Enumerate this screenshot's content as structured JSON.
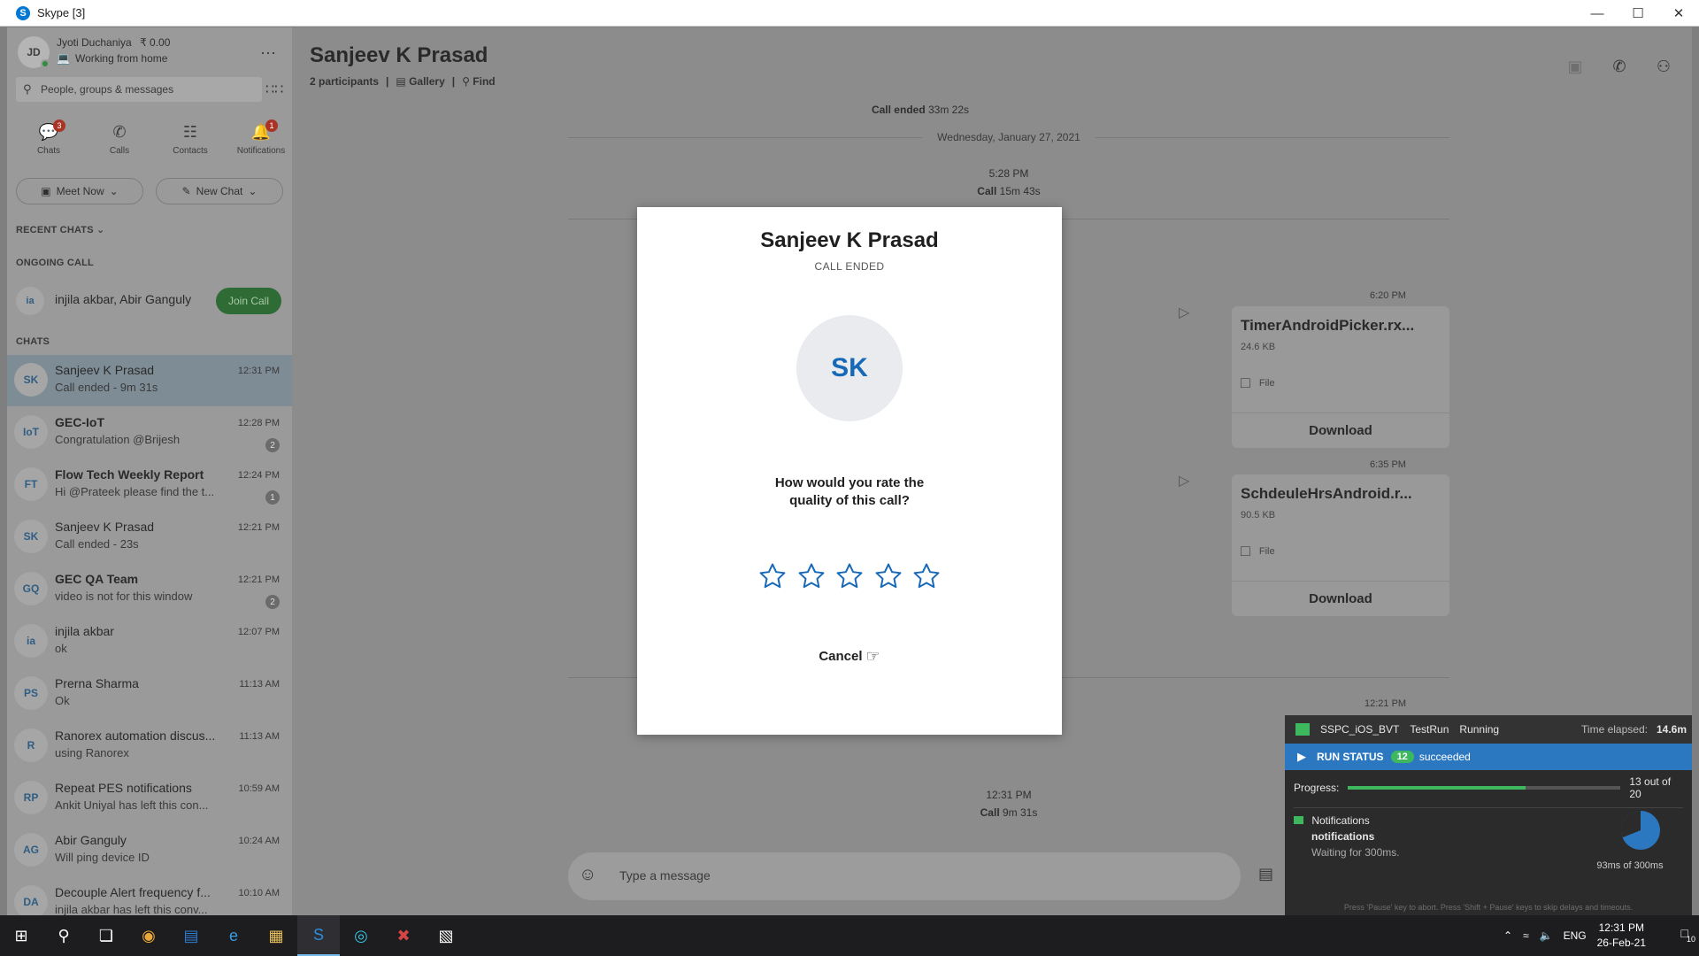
{
  "window": {
    "title": "Skype [3]"
  },
  "profile": {
    "initials": "JD",
    "name": "Jyoti Duchaniya",
    "balance": "₹ 0.00",
    "status": "Working from home"
  },
  "search": {
    "placeholder": "People, groups & messages"
  },
  "nav": [
    {
      "label": "Chats",
      "badge": "3"
    },
    {
      "label": "Calls",
      "badge": ""
    },
    {
      "label": "Contacts",
      "badge": ""
    },
    {
      "label": "Notifications",
      "badge": "1"
    }
  ],
  "actions": {
    "meet_now": "Meet Now",
    "new_chat": "New Chat"
  },
  "sections": {
    "recent": "RECENT CHATS",
    "ongoing": "ONGOING CALL",
    "chats": "CHATS"
  },
  "ongoing_call": {
    "initials": "ia",
    "names": "injila akbar, Abir Ganguly",
    "join": "Join Call"
  },
  "chats": [
    {
      "initials": "SK",
      "name": "Sanjeev K Prasad",
      "preview": "Call ended - 9m 31s",
      "time": "12:31 PM",
      "count": "",
      "bold": false
    },
    {
      "initials": "IoT",
      "name": "GEC-IoT",
      "preview": "Congratulation @Brijesh",
      "time": "12:28 PM",
      "count": "2",
      "bold": true
    },
    {
      "initials": "FT",
      "name": "Flow Tech Weekly Report",
      "preview": "Hi @Prateek please find the t...",
      "time": "12:24 PM",
      "count": "1",
      "bold": true
    },
    {
      "initials": "SK",
      "name": "Sanjeev K Prasad",
      "preview": "Call ended - 23s",
      "time": "12:21 PM",
      "count": "",
      "bold": false
    },
    {
      "initials": "GQ",
      "name": "GEC QA Team",
      "preview": "video is not for this window",
      "time": "12:21 PM",
      "count": "2",
      "bold": true
    },
    {
      "initials": "ia",
      "name": "injila akbar",
      "preview": "ok",
      "time": "12:07 PM",
      "count": "",
      "bold": false
    },
    {
      "initials": "PS",
      "name": "Prerna Sharma",
      "preview": "Ok",
      "time": "11:13 AM",
      "count": "",
      "bold": false
    },
    {
      "initials": "R",
      "name": "Ranorex automation discus...",
      "preview": "using Ranorex",
      "time": "11:13 AM",
      "count": "",
      "bold": false
    },
    {
      "initials": "RP",
      "name": "Repeat PES notifications",
      "preview": "Ankit Uniyal has left this con...",
      "time": "10:59 AM",
      "count": "",
      "bold": false
    },
    {
      "initials": "AG",
      "name": "Abir Ganguly",
      "preview": "Will ping device ID",
      "time": "10:24 AM",
      "count": "",
      "bold": false
    },
    {
      "initials": "DA",
      "name": "Decouple Alert frequency f...",
      "preview": "injila akbar has left this conv...",
      "time": "10:10 AM",
      "count": "",
      "bold": false
    }
  ],
  "conversation": {
    "title": "Sanjeev K Prasad",
    "participants": "2 participants",
    "gallery": "Gallery",
    "find": "Find",
    "call_ended_top": "Call ended",
    "call_ended_top_dur": "33m 22s",
    "date_divider": "Wednesday, January 27, 2021",
    "call1_time": "5:28 PM",
    "call1_label": "Call",
    "call1_dur": "15m 43s",
    "file1": {
      "time": "6:20 PM",
      "name": "TimerAndroidPicker.rx...",
      "size": "24.6 KB",
      "type": "File",
      "download": "Download"
    },
    "file2": {
      "time": "6:35 PM",
      "name": "SchdeuleHrsAndroid.r...",
      "size": "90.5 KB",
      "type": "File",
      "download": "Download"
    },
    "time3": "12:21 PM",
    "call2_time": "12:31 PM",
    "call2_label": "Call",
    "call2_dur": "9m 31s",
    "input_placeholder": "Type a message"
  },
  "modal": {
    "title": "Sanjeev K Prasad",
    "subtitle": "CALL ENDED",
    "initials": "SK",
    "question": "How would you rate the quality of this call?",
    "rating_max": 5,
    "rating_value": 0,
    "cancel": "Cancel"
  },
  "ranorex": {
    "test_name": "SSPC_iOS_BVT",
    "run_label": "TestRun",
    "state": "Running",
    "elapsed_label": "Time elapsed:",
    "elapsed": "14.6m",
    "run_status_label": "RUN STATUS",
    "succeeded_count": "12",
    "succeeded_label": "succeeded",
    "progress_label": "Progress:",
    "progress_text": "13 out of 20",
    "progress_fraction": 0.65,
    "item_title": "Notifications",
    "item_name": "notifications",
    "item_status": "Waiting for 300ms.",
    "timer_text": "93ms of 300ms",
    "timer_fraction": 0.31,
    "footer": "Press 'Pause' key to abort. Press 'Shift + Pause' keys to skip delays and timeouts."
  },
  "taskbar": {
    "time": "12:31 PM",
    "date": "26-Feb-21",
    "lang": "ENG",
    "notif_count": "10"
  },
  "colors": {
    "skype_blue": "#0078d4",
    "join_green": "#2f8f3d",
    "ranorex_blue": "#2c78c0",
    "progress_green": "#3eb85f",
    "star_blue": "#1768b6"
  }
}
